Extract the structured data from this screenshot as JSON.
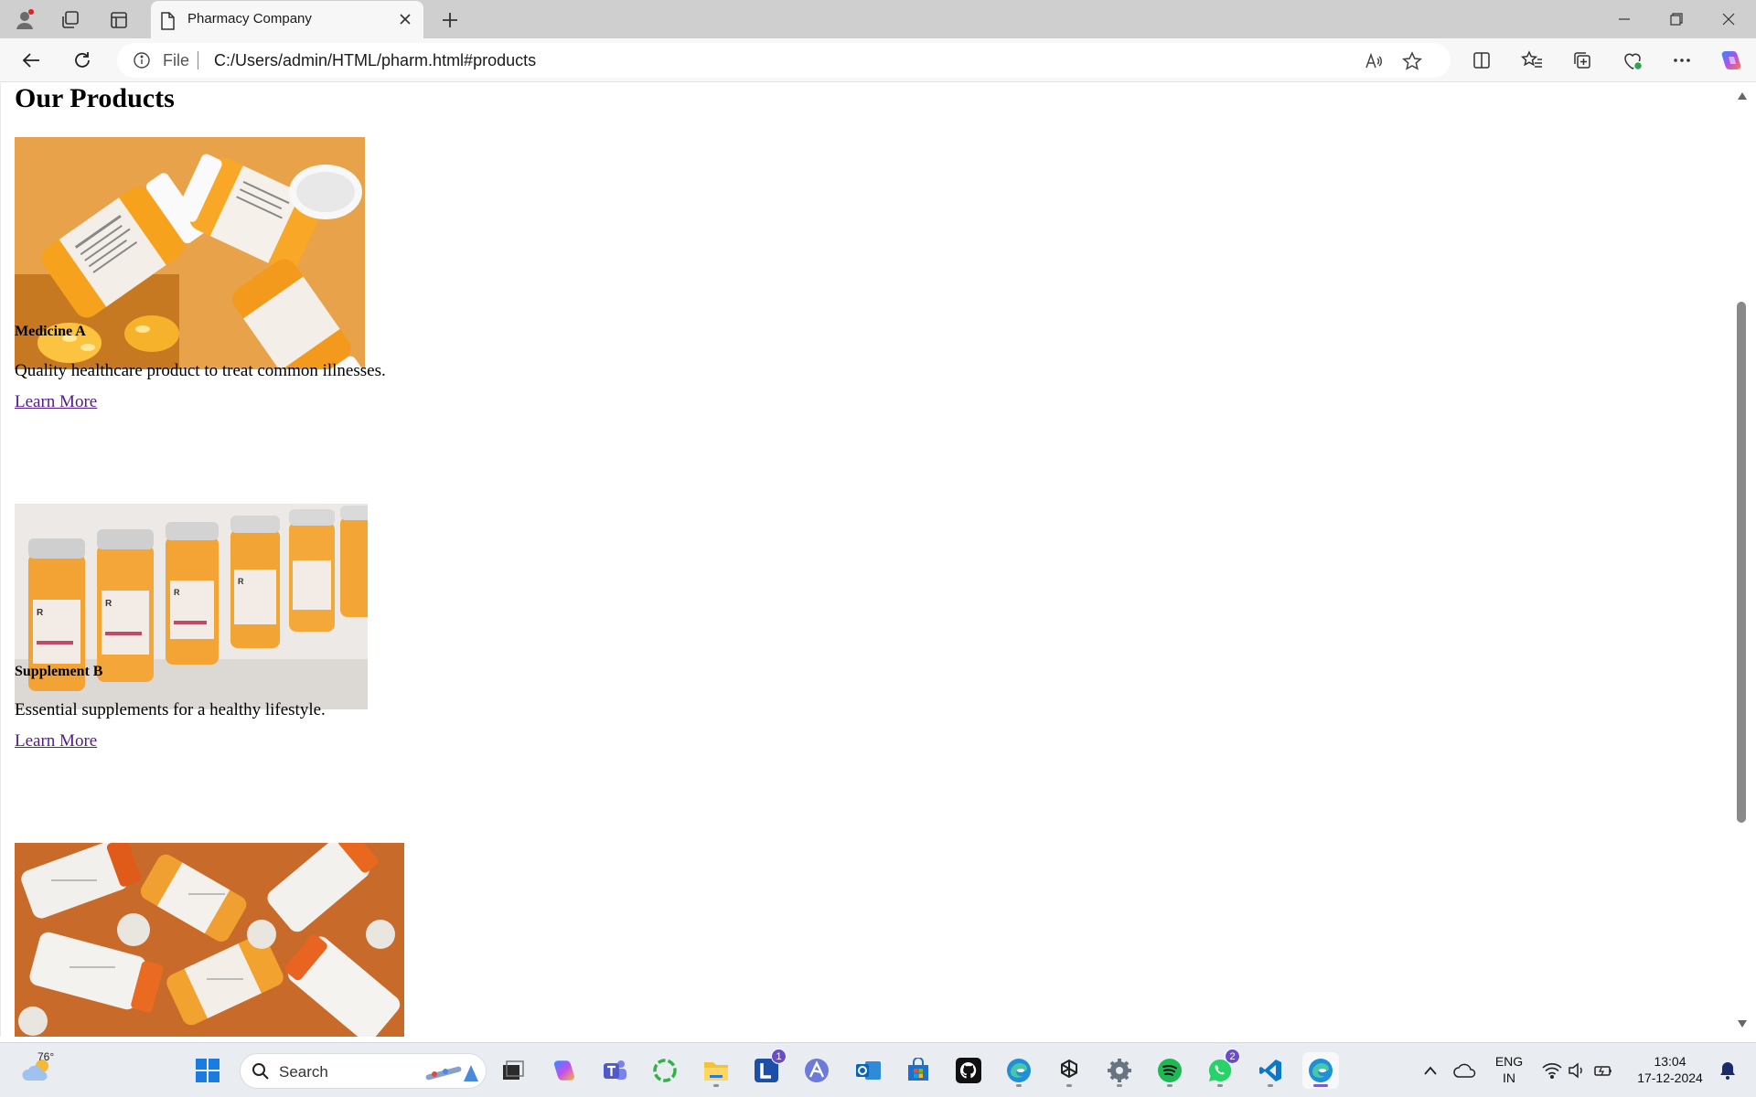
{
  "browser": {
    "tab_title": "Pharmacy Company",
    "address_prefix": "File",
    "url": "C:/Users/admin/HTML/pharm.html#products"
  },
  "page": {
    "heading": "Our Products",
    "products": [
      {
        "name": "Medicine A",
        "description": "Quality healthcare product to treat common illnesses.",
        "link": "Learn More"
      },
      {
        "name": "Supplement B",
        "description": "Essential supplements for a healthy lifestyle.",
        "link": "Learn More"
      },
      {
        "name": "",
        "description": "",
        "link": ""
      }
    ]
  },
  "taskbar": {
    "weather_temp": "76°",
    "search_placeholder": "Search",
    "badges": {
      "l_app": "1",
      "whatsapp": "2"
    },
    "language_line1": "ENG",
    "language_line2": "IN",
    "time": "13:04",
    "date": "17-12-2024"
  },
  "colors": {
    "link_visited": "#551a8b",
    "titlebar": "#cfcfcf",
    "taskbar": "#e9ecf1",
    "accent": "#7a5bd3"
  }
}
